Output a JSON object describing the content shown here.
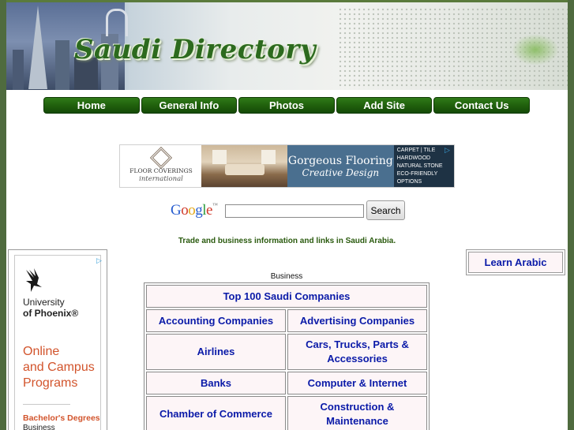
{
  "header": {
    "site_title": "Saudi Directory"
  },
  "nav": {
    "items": [
      {
        "label": "Home"
      },
      {
        "label": "General Info"
      },
      {
        "label": "Photos"
      },
      {
        "label": "Add Site"
      },
      {
        "label": "Contact Us"
      }
    ]
  },
  "top_ad": {
    "brand_line1": "FLOOR COVERINGS",
    "brand_line2": "international",
    "headline": "Gorgeous Flooring",
    "subhead": "Creative Design",
    "features": [
      "CARPET | TILE",
      "HARDWOOD",
      "NATURAL STONE",
      "ECO-FRIENDLY",
      "OPTIONS"
    ],
    "adchoices_icon": "adchoices-icon"
  },
  "search": {
    "logo_text": "Google",
    "logo_tm": "™",
    "input_value": "",
    "button_label": "Search"
  },
  "tagline": "Trade and business information and links in Saudi Arabia.",
  "left_ad": {
    "logo_icon": "phoenix-bird-icon",
    "name_line1": "University",
    "name_line2": "of Phoenix®",
    "promo_lines": [
      "Online",
      "and Campus",
      "Programs"
    ],
    "degree_line": "Bachelor's Degrees",
    "degree_sub": "Business"
  },
  "right_box": {
    "label": "Learn Arabic"
  },
  "directory": {
    "section_label": "Business",
    "top_link": "Top 100 Saudi Companies",
    "rows": [
      [
        "Accounting Companies",
        "Advertising Companies"
      ],
      [
        "Airlines",
        "Cars, Trucks, Parts & Accessories"
      ],
      [
        "Banks",
        "Computer & Internet"
      ],
      [
        "Chamber of Commerce",
        "Construction & Maintenance"
      ]
    ]
  },
  "colors": {
    "nav_green": "#1f5e0c",
    "link_blue": "#0a1aa8",
    "cell_bg": "#fdf5f7",
    "tagline_green": "#2a5a0e",
    "outer_bg": "#4f6b3e"
  }
}
